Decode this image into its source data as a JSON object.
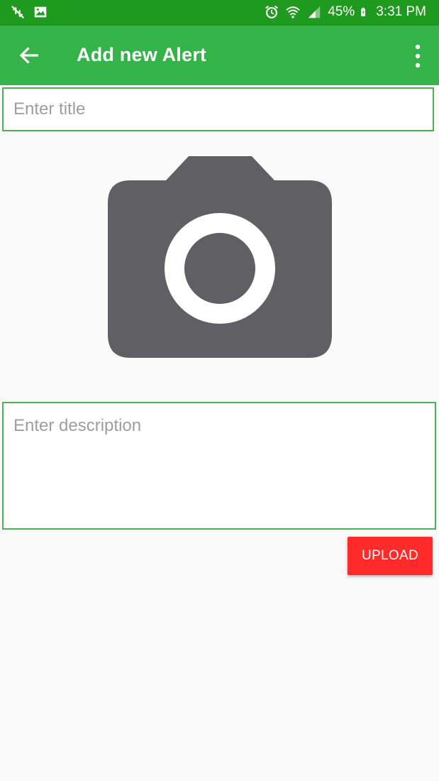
{
  "status_bar": {
    "battery": "45%",
    "time": "3:31 PM",
    "icons": [
      "no-signal-transfer-icon",
      "image-icon",
      "alarm-icon",
      "wifi-icon",
      "cell-signal-icon",
      "battery-charging-icon"
    ]
  },
  "app_bar": {
    "title": "Add new Alert",
    "back_icon": "arrow-back-icon",
    "menu_icon": "more-vert-icon",
    "color": "#34b349",
    "status_color": "#1e9a1e"
  },
  "form": {
    "title_placeholder": "Enter title",
    "title_value": "",
    "image_icon": "camera-icon",
    "description_placeholder": "Enter description",
    "description_value": "",
    "upload_label": "UPLOAD",
    "upload_color": "#ff2a2a",
    "field_border_color": "#4caf50"
  }
}
